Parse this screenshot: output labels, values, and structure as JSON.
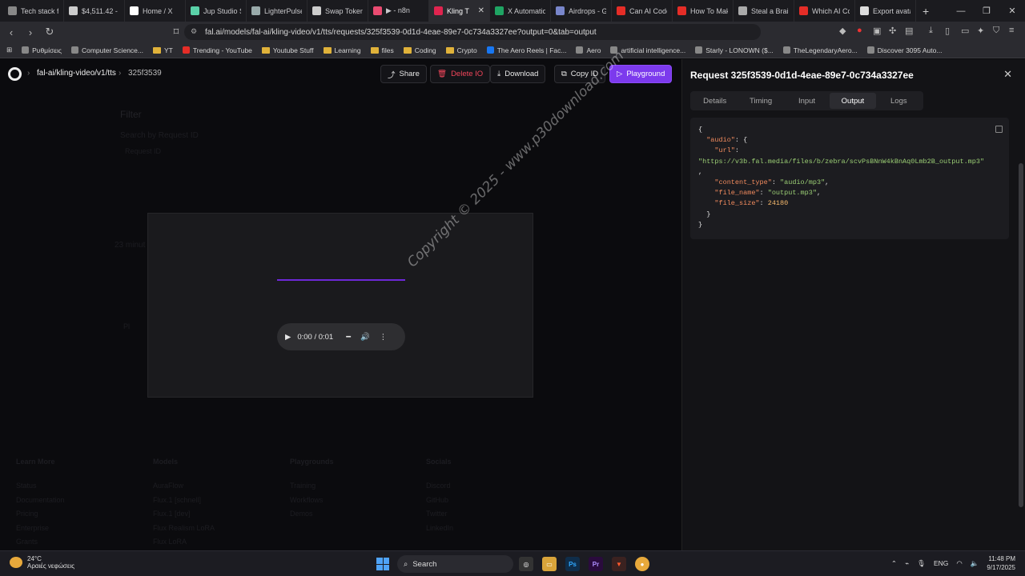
{
  "tabs": [
    {
      "label": "Tech stack fo",
      "color": "#888"
    },
    {
      "label": "$4,511.42 -",
      "color": "#ccc"
    },
    {
      "label": "Home / X",
      "color": "#fff"
    },
    {
      "label": "Jup Studio S",
      "color": "#5ad1a8"
    },
    {
      "label": "LighterPulse",
      "color": "#9aa"
    },
    {
      "label": "Swap Token",
      "color": "#ccc"
    },
    {
      "label": "▶ - n8n",
      "color": "#ea4b71"
    },
    {
      "label": "Kling T",
      "color": "#e0244f",
      "active": true
    },
    {
      "label": "X Automatio",
      "color": "#1fa463"
    },
    {
      "label": "Airdrops - G",
      "color": "#7986cb"
    },
    {
      "label": "Can AI Code",
      "color": "#e52d27"
    },
    {
      "label": "How To Mak",
      "color": "#e52d27"
    },
    {
      "label": "Steal a Brair",
      "color": "#aaa"
    },
    {
      "label": "Which AI Co",
      "color": "#e52d27"
    },
    {
      "label": "Export avata",
      "color": "#ddd"
    }
  ],
  "address": {
    "url": "fal.ai/models/fal-ai/kling-video/v1/tts/requests/325f3539-0d1d-4eae-89e7-0c734a3327ee?output=0&tab=output"
  },
  "bookmarks": [
    {
      "label": "Ρυθμίσεις",
      "type": "icon"
    },
    {
      "label": "Computer Science...",
      "type": "icon"
    },
    {
      "label": "YT",
      "type": "folder"
    },
    {
      "label": "Trending - YouTube",
      "type": "yt"
    },
    {
      "label": "Youtube Stuff",
      "type": "folder"
    },
    {
      "label": "Learning",
      "type": "folder"
    },
    {
      "label": "files",
      "type": "folder"
    },
    {
      "label": "Coding",
      "type": "folder"
    },
    {
      "label": "Crypto",
      "type": "folder"
    },
    {
      "label": "The Aero Reels | Fac...",
      "type": "fb"
    },
    {
      "label": "Aero",
      "type": "icon"
    },
    {
      "label": "artificial intelligence...",
      "type": "icon"
    },
    {
      "label": "Starly - LONOWN ($...",
      "type": "icon"
    },
    {
      "label": "TheLegendaryAero...",
      "type": "icon"
    },
    {
      "label": "Discover 3095 Auto...",
      "type": "icon"
    }
  ],
  "topbar": {
    "crumb1": "fal-ai/kling-video/v1/tts",
    "crumb2": "325f3539",
    "share": "Share",
    "delete": "Delete IO",
    "download": "Download",
    "copy": "Copy ID",
    "playground": "Playground"
  },
  "background": {
    "filter": "Filter",
    "search": "Search by Request ID",
    "reqid": "Request ID",
    "time": "23 minut",
    "play": "Pl",
    "cols": [
      {
        "head": "Learn More",
        "items": [
          "Status",
          "Documentation",
          "Pricing",
          "Enterprise",
          "Grants"
        ]
      },
      {
        "head": "Models",
        "items": [
          "AuraFlow",
          "Flux.1 [schnell]",
          "Flux.1 [dev]",
          "Flux Realism LoRA",
          "Flux LoRA"
        ]
      },
      {
        "head": "Playgrounds",
        "items": [
          "Training",
          "Workflows",
          "Demos"
        ]
      },
      {
        "head": "Socials",
        "items": [
          "Discord",
          "GitHub",
          "Twitter",
          "LinkedIn"
        ]
      }
    ]
  },
  "player": {
    "time": "0:00 / 0:01"
  },
  "watermark": "Copyright © 2025 - www.p30download.com",
  "panel": {
    "title": "Request 325f3539-0d1d-4eae-89e7-0c734a3327ee",
    "tabs": [
      "Details",
      "Timing",
      "Input",
      "Output",
      "Logs"
    ],
    "active": "Output",
    "json": {
      "url": "https://v3b.fal.media/files/b/zebra/scvPsBNnW4kBnAq0Lmb2B_output.mp3",
      "content_type": "audio/mp3",
      "file_name": "output.mp3",
      "file_size": "24180"
    }
  },
  "taskbar": {
    "temp": "24°C",
    "weather": "Αραιές νεφώσεις",
    "search": "Search",
    "lang": "ENG",
    "time": "11:48 PM",
    "date": "9/17/2025"
  }
}
